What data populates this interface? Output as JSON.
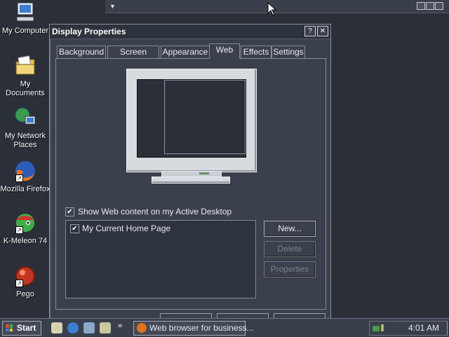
{
  "desktop": {
    "icons": [
      {
        "label_line1": "My Computer",
        "label_line2": "",
        "icon": "computer-icon"
      },
      {
        "label_line1": "My Documents",
        "label_line2": "",
        "icon": "documents-folder-icon"
      },
      {
        "label_line1": "My Network",
        "label_line2": "Places",
        "icon": "network-places-icon"
      },
      {
        "label_line1": "Mozilla Firefox",
        "label_line2": "",
        "icon": "firefox-icon"
      },
      {
        "label_line1": "K-Meleon 74",
        "label_line2": "",
        "icon": "k-meleon-icon"
      },
      {
        "label_line1": "Pego",
        "label_line2": "",
        "icon": "pego-icon"
      }
    ]
  },
  "dialog": {
    "title": "Display Properties",
    "help_button": "?",
    "close_button": "✕",
    "tabs": [
      "Background",
      "Screen Saver",
      "Appearance",
      "Web",
      "Effects",
      "Settings"
    ],
    "active_tab": "Web",
    "show_web_content_label": "Show Web content on my Active Desktop",
    "show_web_content_checked": true,
    "list_items": [
      {
        "label": "My Current Home Page",
        "checked": true
      }
    ],
    "buttons": {
      "new": "New...",
      "delete": "Delete",
      "properties": "Properties"
    }
  },
  "taskbar": {
    "start_label": "Start",
    "quick_launch_more": "»",
    "task_button_label": "Web browser for business...",
    "clock": "4:01 AM"
  },
  "colors": {
    "desktop": "#2a2f38",
    "dialog": "#3b414c",
    "taskbar": "#3a404b",
    "text": "#e6e9ee"
  }
}
